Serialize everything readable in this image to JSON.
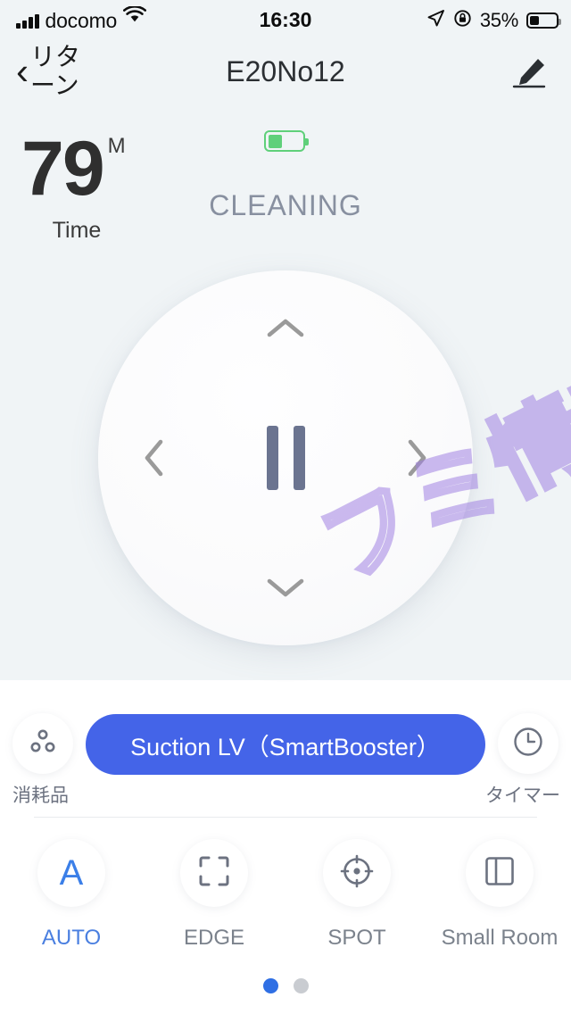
{
  "status_bar": {
    "carrier": "docomo",
    "wifi_icon": "wifi-icon",
    "time": "16:30",
    "location_icon": "location-arrow-icon",
    "rotation_lock_icon": "rotation-lock-icon",
    "battery_percent": "35%",
    "battery_level": 35
  },
  "header": {
    "back_chevron": "‹",
    "back_label": "リターン",
    "title": "E20No12",
    "edit_icon": "pencil-edit-icon"
  },
  "time_block": {
    "value": "79",
    "unit": "M",
    "label": "Time"
  },
  "robot": {
    "battery_level": 42,
    "battery_color": "#5fd07a",
    "status": "CLEANING",
    "status_color": "#8890a0"
  },
  "dpad": {
    "up_icon": "chevron-up-icon",
    "down_icon": "chevron-down-icon",
    "left_icon": "chevron-left-icon",
    "right_icon": "chevron-right-icon",
    "center_icon": "pause-icon",
    "center_color": "#6b7490"
  },
  "suction_row": {
    "consumables": {
      "icon": "consumables-dots-icon",
      "label": "消耗品"
    },
    "suction_button": {
      "label": "Suction LV（SmartBooster）",
      "color": "#4464e8"
    },
    "timer": {
      "icon": "clock-icon",
      "label": "タイマー"
    }
  },
  "modes": [
    {
      "id": "auto",
      "icon": "letter-a-icon",
      "label": "AUTO",
      "active": true
    },
    {
      "id": "edge",
      "icon": "edge-frame-icon",
      "label": "EDGE",
      "active": false
    },
    {
      "id": "spot",
      "icon": "spot-target-icon",
      "label": "SPOT",
      "active": false
    },
    {
      "id": "small-room",
      "icon": "small-room-icon",
      "label": "Small Room",
      "active": false
    }
  ],
  "pagination": {
    "total": 2,
    "active_index": 0,
    "active_color": "#2f6fe4",
    "inactive_color": "#c9ccd1"
  },
  "watermark": {
    "text": "フミ情報",
    "color": "#a082e1"
  }
}
